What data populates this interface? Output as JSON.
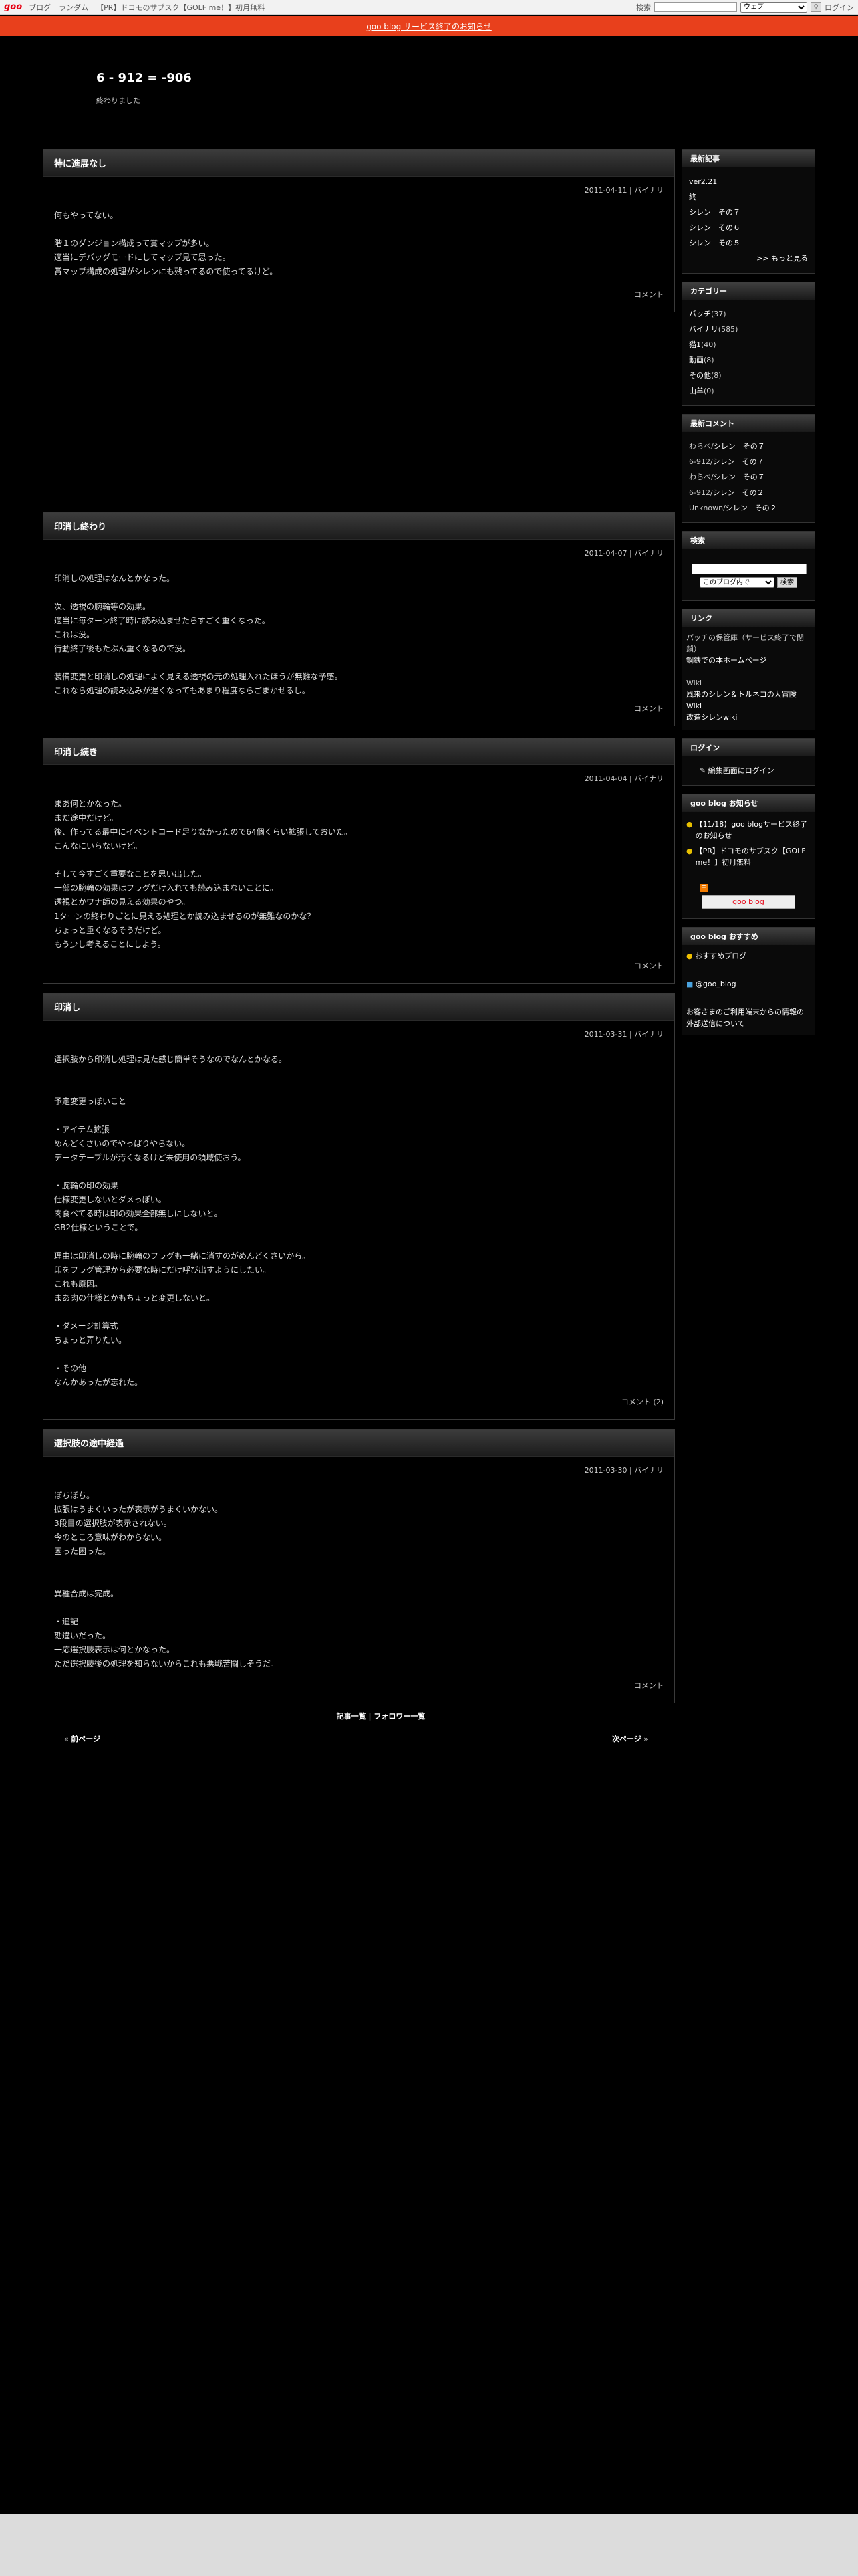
{
  "topbar": {
    "logo": "goo",
    "links": [
      "ブログ",
      "ランダム",
      "【PR】ドコモのサブスク【GOLF me！】初月無料"
    ],
    "search_label": "検索",
    "search_select": "ウェブ",
    "search_btn_icon": "magnifier-icon",
    "login": "ログイン"
  },
  "notice": {
    "text": "goo blog サービス終了のお知らせ"
  },
  "blog": {
    "title": "6 - 912 = -906",
    "description": "終わりました"
  },
  "posts": [
    {
      "title": "特に進展なし",
      "meta": "2011-04-11 | バイナリ",
      "lines": [
        "何もやってない。",
        "",
        "階１のダンジョン構成って賞マップが多い。",
        "適当にデバッグモードにしてマップ見て思った。",
        "賞マップ構成の処理がシレンにも残ってるので使ってるけど。"
      ],
      "footer": "コメント"
    },
    {
      "title": "印消し終わり",
      "meta": "2011-04-07 | バイナリ",
      "lines": [
        "印消しの処理はなんとかなった。",
        "",
        "次、透視の腕輪等の効果。",
        "適当に毎ターン終了時に読み込ませたらすごく重くなった。",
        "これは没。",
        "行動終了後もたぶん重くなるので没。",
        "",
        "装備変更と印消しの処理によく見える透視の元の処理入れたほうが無難な予感。",
        "これなら処理の読み込みが遅くなってもあまり程度ならごまかせるし。"
      ],
      "footer": "コメント"
    },
    {
      "title": "印消し続き",
      "meta": "2011-04-04 | バイナリ",
      "lines": [
        "まあ何とかなった。",
        "まだ途中だけど。",
        "後、作ってる最中にイベントコード足りなかったので64個くらい拡張しておいた。",
        "こんなにいらないけど。",
        "",
        "そして今すごく重要なことを思い出した。",
        "一部の腕輪の効果はフラグだけ入れても読み込まないことに。",
        "透視とかワナ師の見える効果のやつ。",
        "1ターンの終わりごとに見える処理とか読み込ませるのが無難なのかな？",
        "ちょっと重くなるそうだけど。",
        "もう少し考えることにしよう。"
      ],
      "footer": "コメント"
    },
    {
      "title": "印消し",
      "meta": "2011-03-31 | バイナリ",
      "lines": [
        "選択肢から印消し処理は見た感じ簡単そうなのでなんとかなる。",
        "",
        "",
        "予定変更っぽいこと",
        "",
        "・アイテム拡張",
        "めんどくさいのでやっぱりやらない。",
        "データテーブルが汚くなるけど未使用の領域使おう。",
        "",
        "・腕輪の印の効果",
        "仕様変更しないとダメっぽい。",
        "肉食べてる時は印の効果全部無しにしないと。",
        "GB2仕様ということで。",
        "",
        "理由は印消しの時に腕輪のフラグも一緒に消すのがめんどくさいから。",
        "印をフラグ管理から必要な時にだけ呼び出すようにしたい。",
        "これも原因。",
        "まあ肉の仕様とかもちょっと変更しないと。",
        "",
        "・ダメージ計算式",
        "ちょっと弄りたい。",
        "",
        "・その他",
        "なんかあったが忘れた。"
      ],
      "footer": "コメント (2)"
    },
    {
      "title": "選択肢の途中経過",
      "meta": "2011-03-30 | バイナリ",
      "lines": [
        "ぼちぼち。",
        "拡張はうまくいったが表示がうまくいかない。",
        "3段目の選択肢が表示されない。",
        "今のところ意味がわからない。",
        "困った困った。",
        "",
        "",
        "異種合成は完成。",
        "",
        "・追記",
        "勘違いだった。",
        "一応選択肢表示は何とかなった。",
        "ただ選択肢後の処理を知らないからこれも悪戦苦闘しそうだ。"
      ],
      "footer": "コメント"
    }
  ],
  "sidebar": {
    "recent": {
      "title": "最新記事",
      "items": [
        "ver2.21",
        "終",
        "シレン　その７",
        "シレン　その６",
        "シレン　その５"
      ],
      "more": ">> もっと見る"
    },
    "categories": {
      "title": "カテゴリー",
      "items": [
        {
          "name": "パッチ",
          "count": "(37)"
        },
        {
          "name": "バイナリ",
          "count": "(585)"
        },
        {
          "name": "猫1",
          "count": "(40)"
        },
        {
          "name": "動画",
          "count": "(8)"
        },
        {
          "name": "その他",
          "count": "(8)"
        },
        {
          "name": "山羊",
          "count": "(0)"
        }
      ]
    },
    "comments": {
      "title": "最新コメント",
      "items": [
        {
          "who": "わらべ/",
          "post": "シレン　その７"
        },
        {
          "who": "6-912/",
          "post": "シレン　その７"
        },
        {
          "who": "わらべ/",
          "post": "シレン　その７"
        },
        {
          "who": "6-912/",
          "post": "シレン　その２"
        },
        {
          "who": "Unknown/",
          "post": "シレン　その２"
        }
      ]
    },
    "search": {
      "title": "検索",
      "scope": "このブログ内で",
      "button": "検索"
    },
    "links": {
      "title": "リンク",
      "note1": "パッチの保管庫（サービス終了で閉鎖）",
      "link1": "鋼鉄での本ホームページ",
      "note2": "Wiki",
      "link2": "風来のシレン＆トルネコの大冒険 Wiki",
      "link3": "改造シレンwiki"
    },
    "login": {
      "title": "ログイン",
      "text": "編集画面にログイン"
    },
    "news": {
      "title": "goo blog お知らせ",
      "items": [
        "【11/18】goo blogサービス終了のお知らせ",
        "【PR】ドコモのサブスク【GOLF me！】初月無料"
      ],
      "button": "goo blog"
    },
    "recommend": {
      "title": "goo blog おすすめ",
      "item1": "おすすめブログ",
      "item2": "@goo_blog",
      "item3": "お客さまのご利用端末からの情報の外部送信について"
    }
  },
  "pager": {
    "all_posts": "記事一覧",
    "sep": " | ",
    "follower": "フォロワー一覧",
    "prev": "前ページ",
    "next": "次ページ"
  },
  "colors": {
    "notice_bg": "#e8401c",
    "page_bg": "#000000",
    "logo_red": "#e60012"
  }
}
